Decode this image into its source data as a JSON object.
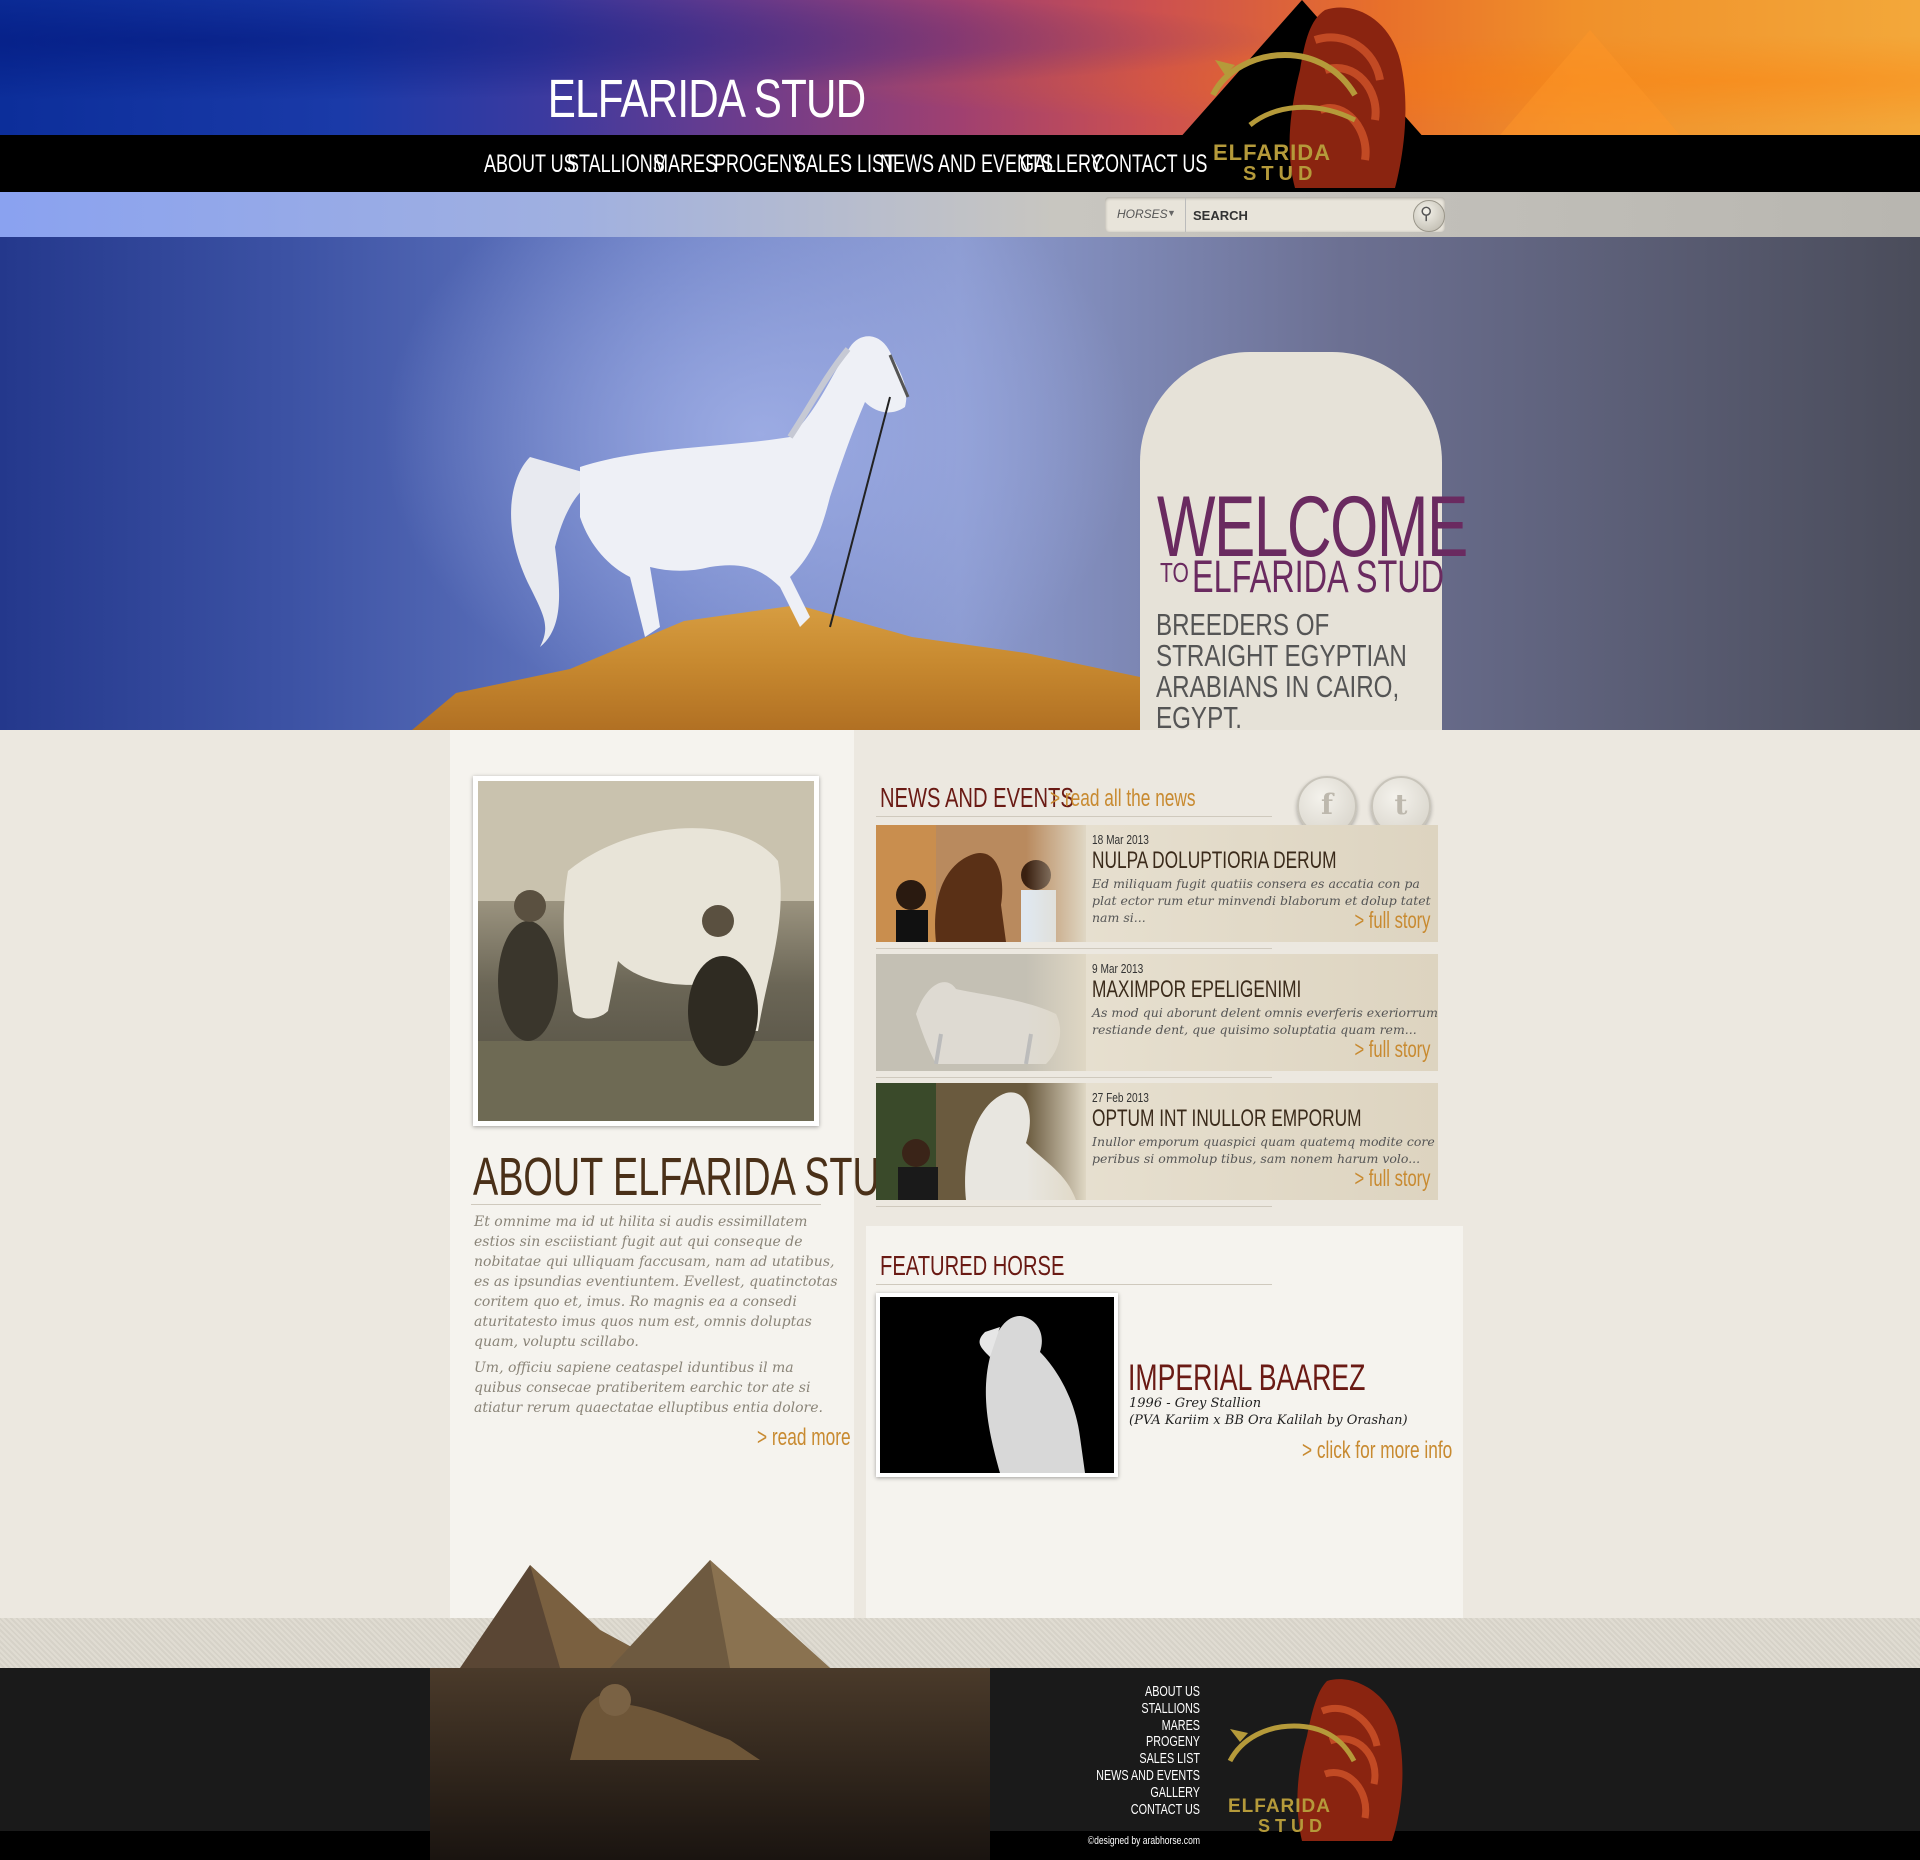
{
  "site": {
    "title": "ELFARIDA STUD"
  },
  "nav": {
    "items": [
      "ABOUT US",
      "STALLIONS",
      "MARES",
      "PROGENY",
      "SALES LIST",
      "NEWS AND EVENTS",
      "GALLERY",
      "CONTACT US"
    ]
  },
  "logo": {
    "name": "ELFARIDA",
    "sub": "STUD"
  },
  "search": {
    "category": "HORSES",
    "placeholder": "SEARCH"
  },
  "hero": {
    "welcome": "WELCOME",
    "to": "TO",
    "subtitle": "ELFARIDA STUD",
    "tagline": "BREEDERS OF STRAIGHT EGYPTIAN ARABIANS IN CAIRO, EGYPT."
  },
  "about": {
    "title": "ABOUT ELFARIDA STUD",
    "paragraphs": [
      "Et omnime ma id ut hilita si audis essimillatem estios sin esciistiant fugit aut qui conseque de nobitatae qui ulliquam faccusam, nam ad utatibus, es as ipsundias eventiuntem. Evellest, quatinctotas coritem quo et, imus. Ro magnis ea a consedi aturitatesto imus quos num est, omnis doluptas quam, voluptu scillabo.",
      "Um, officiu sapiene ceataspel iduntibus il ma quibus consecae pratiberitem earchic tor ate si atiatur rerum quaectatae elluptibus entia dolore."
    ],
    "read_more": "> read more"
  },
  "news": {
    "title": "NEWS AND EVENTS",
    "read_all": "> read all the news",
    "items": [
      {
        "date": "18 Mar 2013",
        "headline": "NULPA DOLUPTIORIA DERUM",
        "excerpt": "Ed miliquam fugit quatiis consera es accatia con pa plat ector rum etur minvendi blaborum et dolup tatet nam si...",
        "more": "> full story"
      },
      {
        "date": "9 Mar 2013",
        "headline": "MAXIMPOR EPELIGENIMI",
        "excerpt": "As mod qui aborunt delent omnis everferis exeriorrum restiande dent, que quisimo soluptatia quam rem...",
        "more": "> full story"
      },
      {
        "date": "27 Feb 2013",
        "headline": "OPTUM INT INULLOR EMPORUM",
        "excerpt": "Inullor emporum quaspici quam quatemq modite core peribus si ommolup tibus, sam nonem harum volo...",
        "more": "> full story"
      }
    ]
  },
  "social": {
    "facebook": "f",
    "twitter": "t"
  },
  "featured": {
    "title": "FEATURED HORSE",
    "name": "IMPERIAL BAAREZ",
    "detail1": "1996 - Grey Stallion",
    "detail2": "(PVA Kariim x BB Ora Kalilah by Orashan)",
    "more": "> click for more info"
  },
  "footer": {
    "nav": [
      "ABOUT US",
      "STALLIONS",
      "MARES",
      "PROGENY",
      "SALES LIST",
      "NEWS AND EVENTS",
      "GALLERY",
      "CONTACT US"
    ],
    "credit": "©designed by arabhorse.com"
  }
}
